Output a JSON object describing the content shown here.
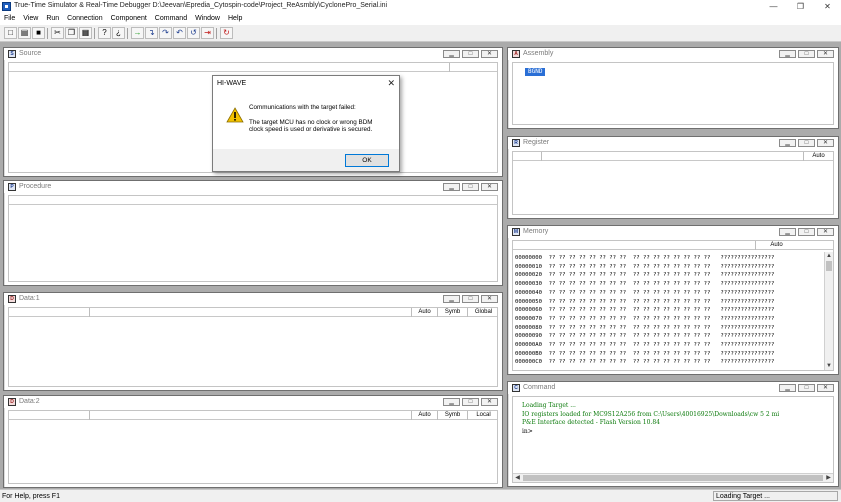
{
  "app": {
    "title": "True-Time Simulator & Real-Time Debugger  D:\\Jeevan\\Epredia_Cytospin-code\\Project_ReAsmbly\\CyclonePro_Serial.ini",
    "window_buttons": {
      "minimize": "—",
      "restore": "❐",
      "close": "✕"
    }
  },
  "menu": [
    "File",
    "View",
    "Run",
    "Connection",
    "Component",
    "Command",
    "Window",
    "Help"
  ],
  "toolbar": {
    "buttons": [
      {
        "name": "new-file-button",
        "glyph": "□"
      },
      {
        "name": "open-file-button",
        "glyph": "▤"
      },
      {
        "name": "save-button",
        "glyph": "■"
      },
      {
        "name": "cut-button",
        "glyph": "✂"
      },
      {
        "name": "copy-button",
        "glyph": "❐"
      },
      {
        "name": "paste-button",
        "glyph": "▦"
      },
      {
        "name": "help-button",
        "glyph": "?"
      },
      {
        "name": "context-help-button",
        "glyph": "¿"
      },
      {
        "name": "start-continue-button",
        "glyph": "→"
      },
      {
        "name": "single-step-button",
        "glyph": "↴"
      },
      {
        "name": "step-over-button",
        "glyph": "↷"
      },
      {
        "name": "step-out-button",
        "glyph": "↶"
      },
      {
        "name": "assembly-step-button",
        "glyph": "↺"
      },
      {
        "name": "halt-button",
        "glyph": "⇥"
      },
      {
        "name": "reset-target-button",
        "glyph": "↻"
      }
    ]
  },
  "windows": {
    "source": {
      "title": "Source"
    },
    "procedure": {
      "title": "Procedure"
    },
    "data1": {
      "title": "Data:1",
      "columns": [
        "Auto",
        "Symb",
        "Global"
      ]
    },
    "data2": {
      "title": "Data:2",
      "columns": [
        "Auto",
        "Symb",
        "Local"
      ]
    },
    "assembly": {
      "title": "Assembly",
      "selected": "BGND"
    },
    "register": {
      "title": "Register",
      "mode": "Auto"
    },
    "memory": {
      "title": "Memory",
      "mode": "Auto",
      "lines": [
        "00000000  ?? ?? ?? ?? ?? ?? ?? ??  ?? ?? ?? ?? ?? ?? ?? ??   ????????????????",
        "00000010  ?? ?? ?? ?? ?? ?? ?? ??  ?? ?? ?? ?? ?? ?? ?? ??   ????????????????",
        "00000020  ?? ?? ?? ?? ?? ?? ?? ??  ?? ?? ?? ?? ?? ?? ?? ??   ????????????????",
        "00000030  ?? ?? ?? ?? ?? ?? ?? ??  ?? ?? ?? ?? ?? ?? ?? ??   ????????????????",
        "00000040  ?? ?? ?? ?? ?? ?? ?? ??  ?? ?? ?? ?? ?? ?? ?? ??   ????????????????",
        "00000050  ?? ?? ?? ?? ?? ?? ?? ??  ?? ?? ?? ?? ?? ?? ?? ??   ????????????????",
        "00000060  ?? ?? ?? ?? ?? ?? ?? ??  ?? ?? ?? ?? ?? ?? ?? ??   ????????????????",
        "00000070  ?? ?? ?? ?? ?? ?? ?? ??  ?? ?? ?? ?? ?? ?? ?? ??   ????????????????",
        "00000080  ?? ?? ?? ?? ?? ?? ?? ??  ?? ?? ?? ?? ?? ?? ?? ??   ????????????????",
        "00000090  ?? ?? ?? ?? ?? ?? ?? ??  ?? ?? ?? ?? ?? ?? ?? ??   ????????????????",
        "000000A0  ?? ?? ?? ?? ?? ?? ?? ??  ?? ?? ?? ?? ?? ?? ?? ??   ????????????????",
        "000000B0  ?? ?? ?? ?? ?? ?? ?? ??  ?? ?? ?? ?? ?? ?? ?? ??   ????????????????",
        "000000C0  ?? ?? ?? ?? ?? ?? ?? ??  ?? ?? ?? ?? ?? ?? ?? ??   ????????????????"
      ]
    },
    "command": {
      "title": "Command",
      "lines": [
        "Loading Target ...",
        "IO registers loaded for MC9S12A256 from C:\\Users\\40016925\\Downloads\\cw 5 2 mi",
        "P&E Interface detected - Flash Version 10.84",
        "",
        "in>"
      ]
    }
  },
  "dialog": {
    "title": "HI-WAVE",
    "line1": "Communications with the target failed:",
    "line2": "The target MCU has no clock or wrong BDM",
    "line3": "clock speed is used or derivative is secured.",
    "ok_label": "OK"
  },
  "status": {
    "left": "For Help, press F1",
    "right": "Loading Target ..."
  },
  "colors": {
    "mdi_background": "#ababab",
    "command_text": "#0b7a0b",
    "selection": "#2a6fd6",
    "warning": "#f2c200"
  }
}
